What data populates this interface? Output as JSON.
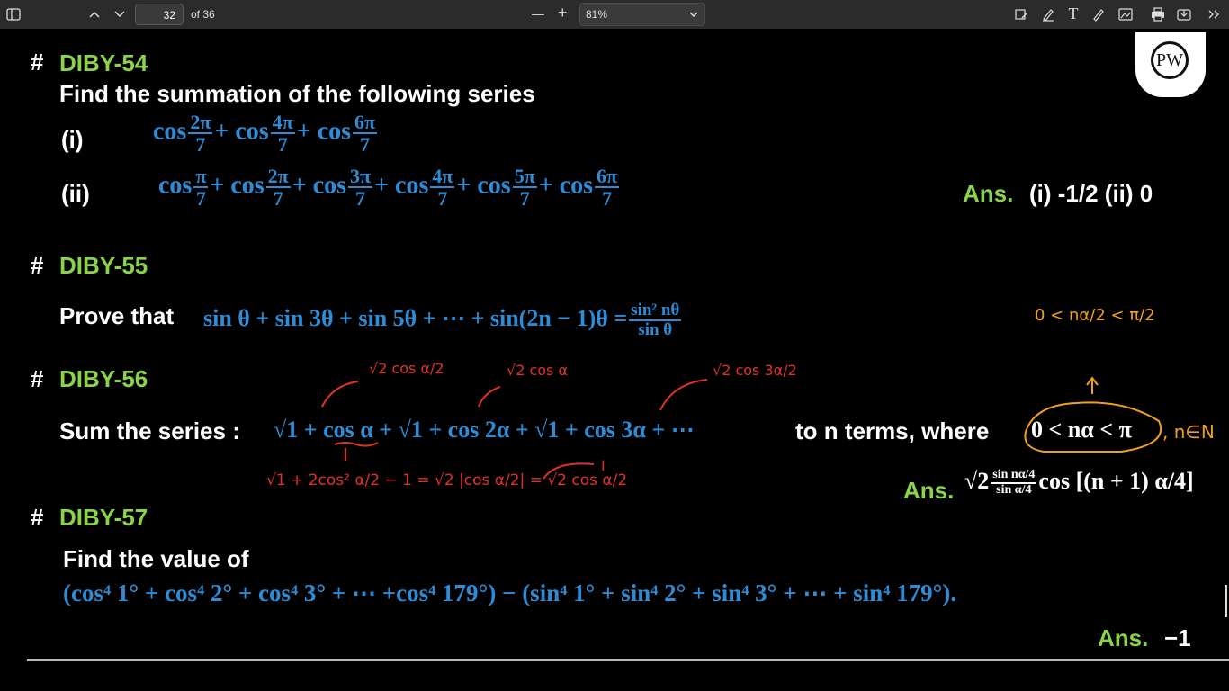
{
  "viewer": {
    "page_current": "32",
    "page_total_label": "of 36",
    "zoom_minus": "—",
    "zoom_plus": "+",
    "zoom_value": "81%"
  },
  "logo": {
    "text": "PW"
  },
  "diby54": {
    "heading": "DIBY-54",
    "hash": "#",
    "prompt": "Find the summation of the following series",
    "label_i": "(i)",
    "label_ii": "(ii)",
    "expr_i": [
      "cos",
      "2π",
      "7",
      "+ cos",
      "4π",
      "7",
      "+ cos",
      "6π",
      "7"
    ],
    "expr_ii": [
      "cos",
      "π",
      "7",
      "+ cos",
      "2π",
      "7",
      "+ cos",
      "3π",
      "7",
      "+ cos",
      "4π",
      "7",
      "+ cos",
      "5π",
      "7",
      "+ cos",
      "6π",
      "7"
    ],
    "ans_label": "Ans.",
    "ans_text": "(i) -1/2  (ii) 0"
  },
  "diby55": {
    "heading": "DIBY-55",
    "hash": "#",
    "prompt": "Prove that",
    "lhs": "sin θ + sin 3θ + sin 5θ + ⋯ + sin(2n − 1)θ =",
    "rhs_num": "sin² nθ",
    "rhs_den": "sin θ"
  },
  "diby56": {
    "heading": "DIBY-56",
    "hash": "#",
    "prompt": "Sum the series :",
    "series": "√1 + cos α + √1 + cos 2α + √1 + cos 3α + ⋯",
    "tail": "to n terms, where",
    "condition": "0 < nα < π",
    "ans_label": "Ans.",
    "ans_expr": "√2",
    "ans_frac_num": "sin nα/4",
    "ans_frac_den": "sin α/4",
    "ans_tail": "cos [(n + 1) α/4]"
  },
  "diby57": {
    "heading": "DIBY-57",
    "hash": "#",
    "prompt": "Find the value of",
    "expr": "(cos⁴ 1° + cos⁴ 2° + cos⁴ 3° + ⋯ +cos⁴ 179°) − (sin⁴ 1° + sin⁴ 2° + sin⁴ 3° + ⋯ + sin⁴ 179°).",
    "ans_label": "Ans.",
    "ans_value": "−1"
  },
  "annotations": {
    "red_1": "√2 cos α/2",
    "red_2": "√2 cos α",
    "red_3": "√2 cos 3α/2",
    "red_work": "√1 + 2cos² α/2 − 1  = √2 |cos α/2| = √2 cos α/2",
    "red_I": "I",
    "orange_cond": "0 < nα/2 < π/2",
    "orange_n": ", n∈N"
  },
  "colors": {
    "toolbar_bg": "#2b2b2b",
    "heading_green": "#8bd34a",
    "math_blue": "#2e8cd6",
    "ink_red": "#e0302a",
    "ink_orange": "#f0a020"
  }
}
